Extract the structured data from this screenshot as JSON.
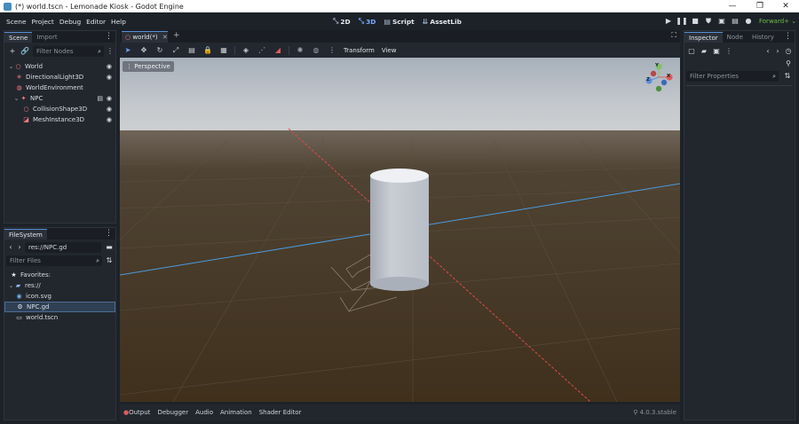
{
  "window": {
    "title": "(*) world.tscn - Lemonade Kiosk - Godot Engine",
    "minimize": "—",
    "maximize": "❐",
    "close": "✕"
  },
  "menu": [
    "Scene",
    "Project",
    "Debug",
    "Editor",
    "Help"
  ],
  "main_tabs": [
    {
      "label": "2D",
      "icon": "2d-icon"
    },
    {
      "label": "3D",
      "icon": "3d-icon"
    },
    {
      "label": "Script",
      "icon": "script-icon"
    },
    {
      "label": "AssetLib",
      "icon": "assetlib-icon"
    }
  ],
  "renderer": "Forward+",
  "colors": {
    "accent": "#5a8fd6",
    "renderer": "#6bc045",
    "x_axis": "#e04a4a",
    "z_axis": "#4a9be0"
  },
  "scene_dock": {
    "tabs": [
      "Scene",
      "Import"
    ],
    "filter_placeholder": "Filter Nodes",
    "nodes": [
      {
        "name": "World",
        "icon": "node3d-icon",
        "level": 0,
        "visible": true
      },
      {
        "name": "DirectionalLight3D",
        "icon": "light-icon",
        "level": 1,
        "visible": true
      },
      {
        "name": "WorldEnvironment",
        "icon": "environment-icon",
        "level": 1,
        "visible": false
      },
      {
        "name": "NPC",
        "icon": "character-icon",
        "level": 1,
        "visible": true
      },
      {
        "name": "CollisionShape3D",
        "icon": "collision-icon",
        "level": 2,
        "visible": true
      },
      {
        "name": "MeshInstance3D",
        "icon": "mesh-icon",
        "level": 2,
        "visible": true
      }
    ]
  },
  "filesystem_dock": {
    "tab": "FileSystem",
    "path": "res://NPC.gd",
    "filter_placeholder": "Filter Files",
    "items": [
      {
        "name": "Favorites:",
        "icon": "star-icon",
        "level": 0
      },
      {
        "name": "res://",
        "icon": "folder-icon",
        "level": 0
      },
      {
        "name": "icon.svg",
        "icon": "svg-file-icon",
        "level": 1
      },
      {
        "name": "NPC.gd",
        "icon": "gear-file-icon",
        "level": 1,
        "selected": true
      },
      {
        "name": "world.tscn",
        "icon": "scene-file-icon",
        "level": 1
      }
    ]
  },
  "editor": {
    "tab": "world(*)",
    "add_tab": "+",
    "toolbar_menus": [
      "Transform",
      "View"
    ],
    "viewport_label": "Perspective",
    "gizmo": {
      "y": "Y",
      "x": "X",
      "z": "Z"
    }
  },
  "bottom_panel": {
    "tabs": [
      "Output",
      "Debugger",
      "Audio",
      "Animation",
      "Shader Editor"
    ],
    "version": "4.0.3.stable"
  },
  "inspector": {
    "tabs": [
      "Inspector",
      "Node",
      "History"
    ],
    "filter_placeholder": "Filter Properties"
  }
}
